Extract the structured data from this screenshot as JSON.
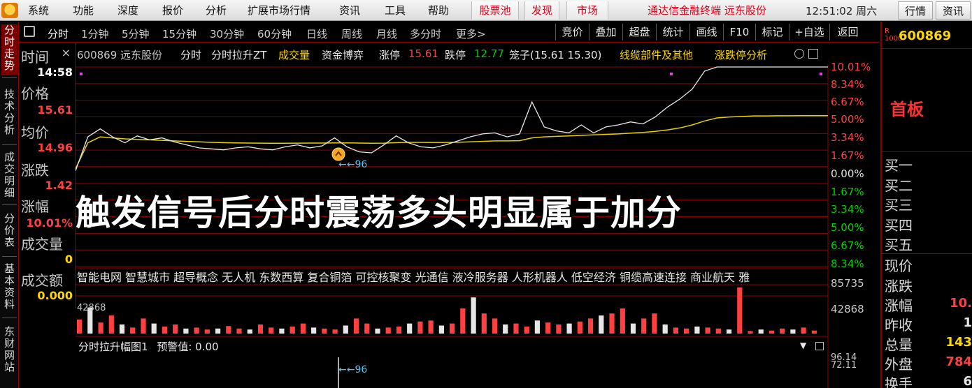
{
  "menu": {
    "items": [
      "系统",
      "功能",
      "深度",
      "报价",
      "分析",
      "扩展市场行情",
      "资讯",
      "工具",
      "帮助"
    ],
    "red_items": [
      "股票池",
      "发现",
      "市场"
    ],
    "banner": "通达信金融终端  远东股份",
    "time": "12:51:02 周六",
    "buttons": [
      "行情",
      "资讯"
    ]
  },
  "vtabs": [
    "分时走势",
    "技术分析",
    "成交明细",
    "分价表",
    "基本资料",
    "东财网站"
  ],
  "toolbar": {
    "periods": [
      "分时",
      "1分钟",
      "5分钟",
      "15分钟",
      "30分钟",
      "60分钟",
      "日线",
      "周线",
      "月线",
      "多分时",
      "更多>"
    ],
    "right": [
      "竞价",
      "叠加",
      "超盘",
      "统计",
      "画线",
      "F10",
      "标记",
      "+自选",
      "返回"
    ]
  },
  "info": {
    "time_label": "时间",
    "time": "14:58",
    "price_label": "价格",
    "price": "15.61",
    "avg_label": "均价",
    "avg": "14.96",
    "change_label": "涨跌",
    "change": "1.42",
    "pct_label": "涨幅",
    "pct": "10.01%",
    "vol_label": "成交量",
    "vol": "0",
    "amount_label": "成交额",
    "amount": "0.000",
    "close": "×"
  },
  "header": {
    "stock": "600869 远东股份",
    "mode": "分时",
    "indicator": "分时拉升ZT",
    "volume": "成交量",
    "fund": "资金博弈",
    "limit_up_label": "涨停",
    "limit_up": "15.61",
    "limit_down_label": "跌停",
    "limit_down": "12.77",
    "cage": "笼子(15.61 15.30)",
    "sector": "线缆部件及其他",
    "analysis": "涨跌停分析"
  },
  "axis": {
    "up": [
      "10.01%",
      "8.34%",
      "6.67%",
      "5.00%",
      "3.34%",
      "1.67%"
    ],
    "zero": "0.00%",
    "down": [
      "1.67%",
      "3.34%",
      "5.00%",
      "6.67%",
      "8.34%"
    ],
    "vol_top": "85735",
    "vol_mid": "42868",
    "ind_top": "96.14",
    "ind_second": "72.11"
  },
  "marker": {
    "label": "96"
  },
  "concepts": "智能电网 智慧城市 超导概念 无人机 东数西算 复合铜箔 可控核聚变 光通信 液冷服务器 人形机器人 低空经济 铜缆高速连接 商业航天 雅",
  "caption": "触发信号后分时震荡多头明显属于加分",
  "indicator_panel": {
    "title": "分时拉升幅图1",
    "warn": "预警值: 0.00",
    "marker": "96"
  },
  "right_panel": {
    "code": "600869",
    "board": "首板",
    "bids": [
      "买一",
      "买二",
      "买三",
      "买四",
      "买五"
    ],
    "quote_labels": [
      "现价",
      "涨跌",
      "涨幅",
      "昨收",
      "总量",
      "外盘",
      "换手"
    ],
    "quote_values": [
      "",
      "",
      "10.",
      "1",
      "143",
      "784",
      "6"
    ]
  },
  "colors": {
    "price_line": "#e8e8e8",
    "avg_line": "#e6d200",
    "up": "#ff4040",
    "down": "#00d000",
    "grid": "#8a0000"
  },
  "chart_data": {
    "type": "line",
    "title": "",
    "ylim_pct": [
      -10.01,
      10.01
    ],
    "series": [
      {
        "name": "",
        "pct": [
          -0.4,
          3.0,
          3.8,
          3.0,
          2.4,
          3.1,
          2.7,
          2.9,
          2.5,
          2.2,
          1.9,
          1.8,
          1.7,
          1.9,
          2.0,
          1.8,
          1.7,
          2.0,
          2.2,
          1.9,
          2.1,
          2.9,
          2.0,
          1.5,
          1.4,
          2.2,
          3.1,
          2.4,
          2.0,
          1.9,
          2.2,
          2.6,
          3.0,
          3.3,
          3.4,
          3.0,
          3.3,
          6.5,
          4.0,
          3.6,
          3.4,
          4.2,
          3.4,
          4.0,
          4.2,
          4.5,
          4.3,
          5.0,
          6.0,
          6.8,
          7.8,
          9.6,
          10.01,
          10.01,
          10.01,
          10.01,
          10.01,
          10.01,
          10.01,
          10.01,
          10.01,
          10.01
        ]
      },
      {
        "name": "",
        "pct": [
          -0.2,
          2.4,
          3.0,
          2.9,
          2.8,
          2.75,
          2.7,
          2.65,
          2.6,
          2.55,
          2.5,
          2.45,
          2.42,
          2.4,
          2.38,
          2.37,
          2.36,
          2.36,
          2.37,
          2.38,
          2.38,
          2.4,
          2.4,
          2.38,
          2.36,
          2.37,
          2.42,
          2.45,
          2.45,
          2.44,
          2.44,
          2.46,
          2.5,
          2.55,
          2.6,
          2.6,
          2.62,
          2.9,
          3.0,
          3.05,
          3.1,
          3.15,
          3.2,
          3.25,
          3.3,
          3.38,
          3.45,
          3.55,
          3.7,
          3.9,
          4.2,
          4.6,
          4.9,
          5.0,
          5.05,
          5.1,
          5.1,
          5.12,
          5.12,
          5.13,
          5.13,
          5.13
        ]
      }
    ],
    "volume": [
      0.28,
      0.52,
      0.22,
      0.36,
      0.18,
      0.12,
      0.3,
      0.2,
      0.14,
      0.18,
      0.1,
      0.12,
      0.08,
      0.1,
      0.15,
      0.1,
      0.08,
      0.18,
      0.12,
      0.1,
      0.14,
      0.2,
      0.12,
      0.1,
      0.08,
      0.16,
      0.3,
      0.2,
      0.1,
      0.12,
      0.14,
      0.2,
      0.24,
      0.26,
      0.16,
      0.2,
      0.5,
      0.72,
      0.4,
      0.3,
      0.18,
      0.2,
      0.14,
      0.26,
      0.22,
      0.18,
      0.2,
      0.24,
      0.3,
      0.36,
      0.4,
      0.5,
      0.2,
      0.3,
      0.4,
      0.18,
      0.12,
      0.1,
      0.14,
      0.12,
      0.1,
      0.08,
      0.92,
      0.05,
      0.08,
      0.06,
      0.1,
      0.08,
      0.12,
      0.06
    ]
  }
}
